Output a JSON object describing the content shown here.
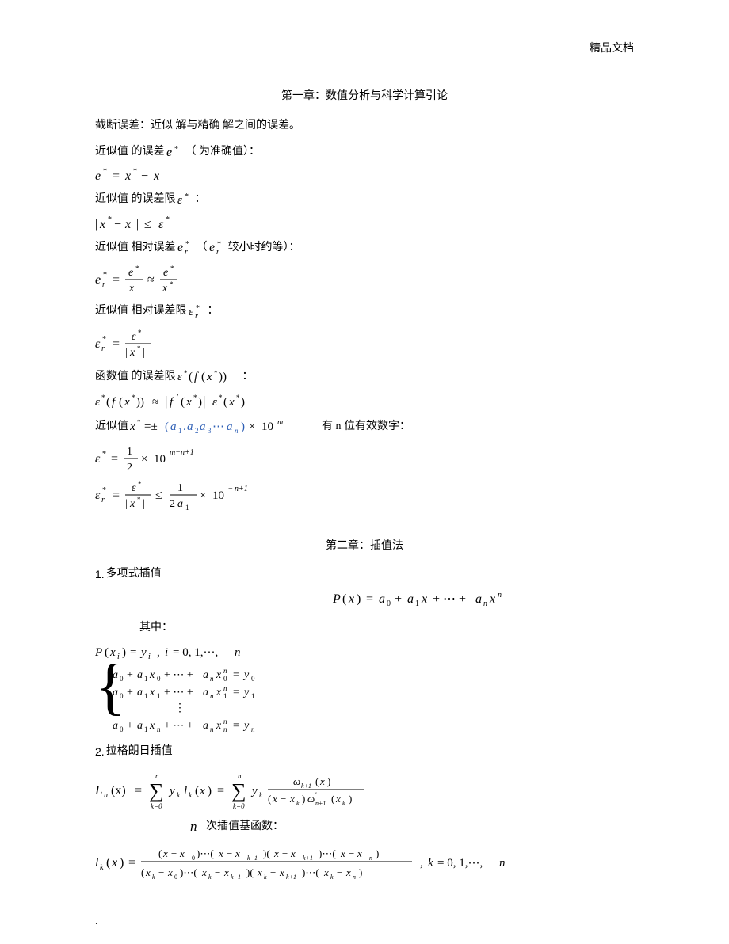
{
  "header": {
    "brand": "精品文档"
  },
  "chapter1": {
    "title": "第一章：数值分析与科学计算引论",
    "lines": {
      "l1": "截断误差：近似  解与精确  解之间的误差。",
      "l2a": "近似值  的误差 ",
      "l2b": "（  为准确值）：",
      "l3": "近似值  的误差限  ",
      "l3b": "：",
      "l4a": "近似值  相对误差  ",
      "l4b": "（ ",
      "l4c": "较小时约等）：",
      "l5": "近似值  相对误差限  ",
      "l5b": "：",
      "l6a": "函数值  的误差限  ",
      "l6b": "：",
      "l7a": "近似值 ",
      "l7b": "有 n 位有效数字："
    }
  },
  "chapter2": {
    "title": "第二章：插值法",
    "s1": {
      "num": "1.",
      "label": "多项式插值"
    },
    "where": "其中：",
    "s2": {
      "num": "2.",
      "label": "拉格朗日插值"
    },
    "basis": "次插值基函数："
  },
  "footer": {
    "dot": "."
  }
}
